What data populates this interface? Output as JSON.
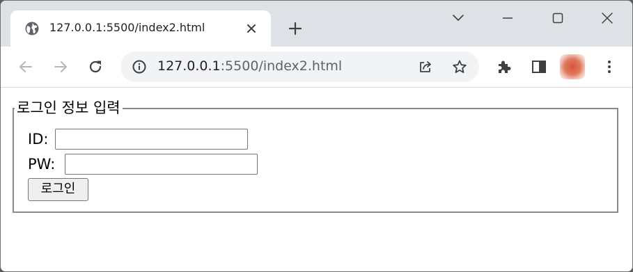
{
  "browser": {
    "tab": {
      "title": "127.0.0.1:5500/index2.html",
      "favicon": "globe-icon"
    },
    "address_bar": {
      "host": "127.0.0.1",
      "path": ":5500/index2.html"
    },
    "icons": {
      "back": "back-arrow-icon",
      "forward": "forward-arrow-icon",
      "reload": "reload-icon",
      "site_info": "info-icon",
      "share": "share-icon",
      "bookmark": "star-icon",
      "extensions": "puzzle-icon",
      "side_panel": "side-panel-icon",
      "menu": "kebab-menu-icon",
      "new_tab": "plus-icon",
      "close_tab": "close-icon",
      "tab_search": "chevron-down-icon",
      "minimize": "minimize-icon",
      "maximize": "maximize-icon",
      "close_window": "close-icon"
    },
    "colors": {
      "tabstrip": "#dee1e6",
      "omnibox": "#f1f3f4",
      "avatar": "#d8543a"
    }
  },
  "page": {
    "fieldset": {
      "legend": "로그인 정보 입력"
    },
    "id_label": "ID:",
    "id_value": "",
    "pw_label": "PW:",
    "pw_value": "",
    "login_button": "로그인"
  }
}
